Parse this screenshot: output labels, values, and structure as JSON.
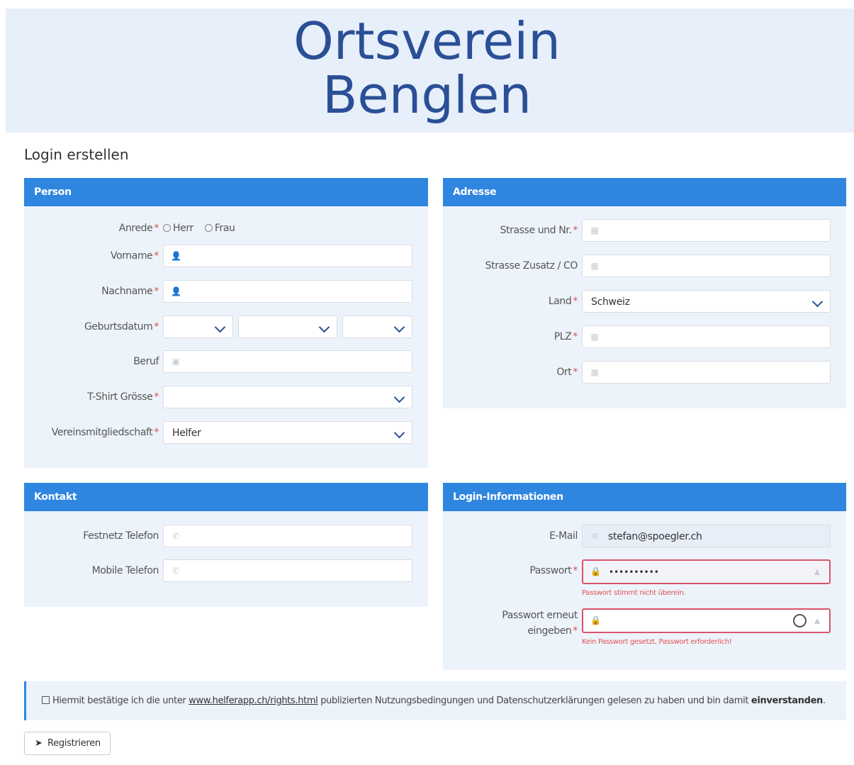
{
  "brand": {
    "line1": "Ortsverein",
    "line2": "Benglen"
  },
  "page_title": "Login erstellen",
  "person": {
    "title": "Person",
    "anrede_label": "Anrede",
    "anrede_options": [
      "Herr",
      "Frau"
    ],
    "vorname_label": "Vorname",
    "nachname_label": "Nachname",
    "geburtsdatum_label": "Geburtsdatum",
    "beruf_label": "Beruf",
    "tshirt_label": "T-Shirt Grösse",
    "tshirt_value": "",
    "mitglied_label": "Vereinsmitgliedschaft",
    "mitglied_value": "Helfer"
  },
  "adresse": {
    "title": "Adresse",
    "strasse_label": "Strasse und Nr.",
    "zusatz_label": "Strasse Zusatz / CO",
    "land_label": "Land",
    "land_value": "Schweiz",
    "plz_label": "PLZ",
    "ort_label": "Ort"
  },
  "kontakt": {
    "title": "Kontakt",
    "festnetz_label": "Festnetz Telefon",
    "mobile_label": "Mobile Telefon"
  },
  "login": {
    "title": "Login-Informationen",
    "email_label": "E-Mail",
    "email_value": "stefan@spoegler.ch",
    "passwort_label": "Passwort",
    "passwort_value": "••••••••••",
    "passwort_error": "Passwort stimmt nicht überein.",
    "passwort2_label_line1": "Passwort erneut",
    "passwort2_label_line2": "eingeben",
    "passwort2_error": "Kein Passwort gesetzt, Passwort erforderlich!"
  },
  "consent": {
    "text_before": "Hiermit bestätige ich die unter ",
    "link": "www.helferapp.ch/rights.html",
    "text_after": " publizierten Nutzungsbedingungen und Datenschutzerklärungen gelesen zu haben und bin damit ",
    "bold": "einverstanden",
    "end": "."
  },
  "register_button": "Registrieren",
  "required_marker": "*",
  "colors": {
    "accent": "#2f86e0",
    "panel_bg": "#edf3fb",
    "brand": "#2a4f96",
    "error": "#d9546a"
  }
}
